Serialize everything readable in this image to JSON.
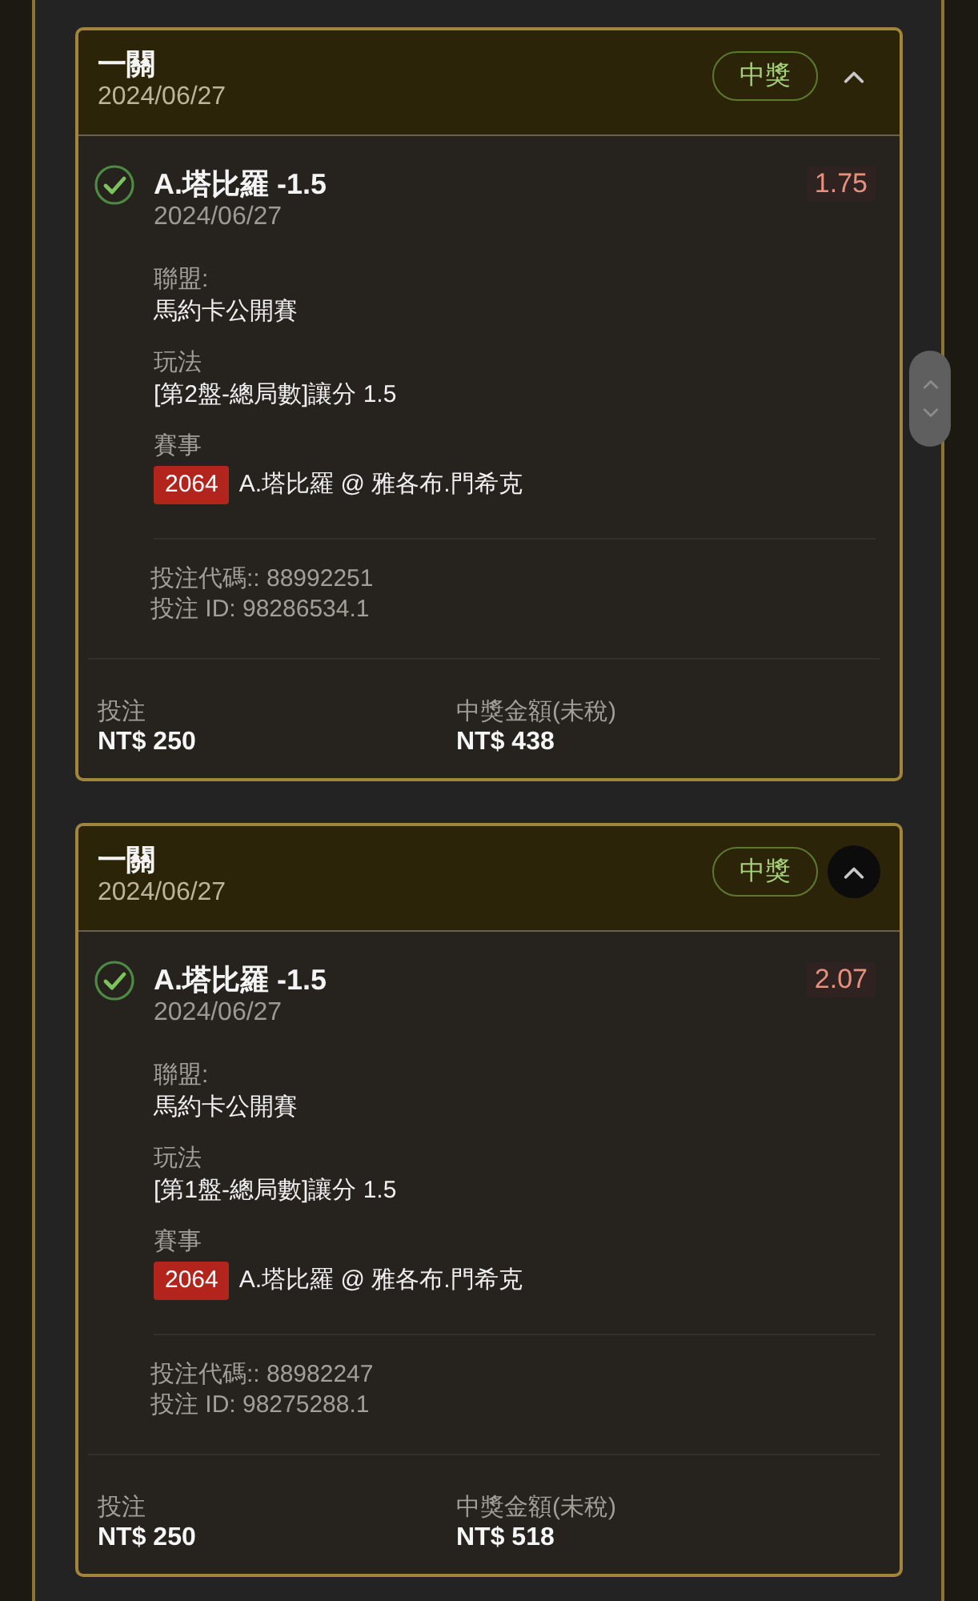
{
  "bets": [
    {
      "bet_type": "一關",
      "date": "2024/06/27",
      "status": {
        "label": "中獎",
        "kind": "won"
      },
      "toggle": {
        "expanded": true,
        "focused": false
      },
      "selection": {
        "won": true,
        "title": "A.塔比羅 -1.5",
        "date": "2024/06/27",
        "odds": "1.75"
      },
      "details": [
        {
          "kind": "text",
          "label": "聯盟:",
          "value": "馬約卡公開賽"
        },
        {
          "kind": "text",
          "label": "玩法",
          "value": "[第2盤-總局數]讓分 1.5"
        },
        {
          "kind": "event",
          "label": "賽事",
          "code": "2064",
          "value": "A.塔比羅 @ 雅各布.門希克"
        }
      ],
      "references": [
        "投注代碼:: 88992251",
        "投注 ID: 98286534.1"
      ],
      "totals": [
        {
          "label": "投注",
          "value": "NT$ 250"
        },
        {
          "label": "中獎金額(未稅)",
          "value": "NT$ 438"
        }
      ]
    },
    {
      "bet_type": "一關",
      "date": "2024/06/27",
      "status": {
        "label": "中獎",
        "kind": "won"
      },
      "toggle": {
        "expanded": true,
        "focused": true
      },
      "selection": {
        "won": true,
        "title": "A.塔比羅 -1.5",
        "date": "2024/06/27",
        "odds": "2.07"
      },
      "details": [
        {
          "kind": "text",
          "label": "聯盟:",
          "value": "馬約卡公開賽"
        },
        {
          "kind": "text",
          "label": "玩法",
          "value": "[第1盤-總局數]讓分 1.5"
        },
        {
          "kind": "event",
          "label": "賽事",
          "code": "2064",
          "value": "A.塔比羅 @ 雅各布.門希克"
        }
      ],
      "references": [
        "投注代碼:: 88982247",
        "投注 ID: 98275288.1"
      ],
      "totals": [
        {
          "label": "投注",
          "value": "NT$ 250"
        },
        {
          "label": "中獎金額(未稅)",
          "value": "NT$ 518"
        }
      ]
    }
  ]
}
